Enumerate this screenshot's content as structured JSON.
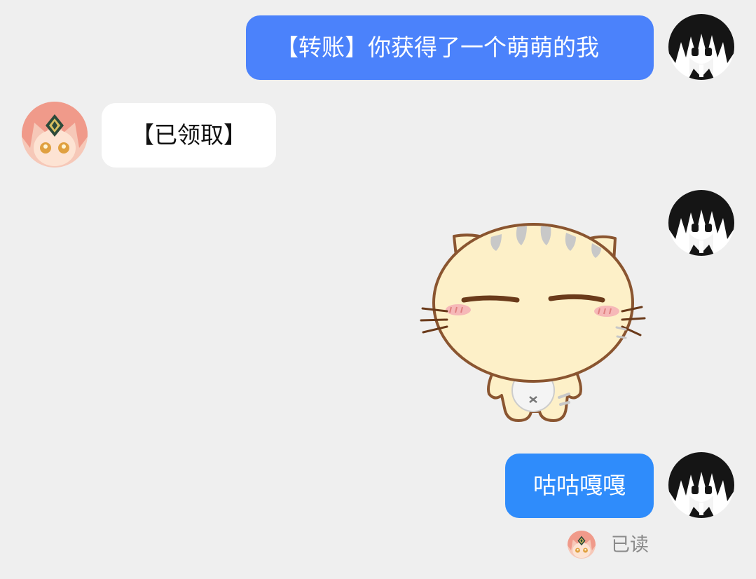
{
  "colors": {
    "background": "#efefef",
    "bubble_out_primary": "#4b82fb",
    "bubble_out_secondary": "#2f8cfb",
    "bubble_in": "#ffffff",
    "read_text": "#8a8a8a"
  },
  "messages": [
    {
      "direction": "outgoing",
      "type": "text",
      "text": "【转账】你获得了一个萌萌的我",
      "avatar": "dark-haired-avatar"
    },
    {
      "direction": "incoming",
      "type": "text",
      "text": "【已领取】",
      "avatar": "pink-haired-avatar"
    },
    {
      "direction": "outgoing",
      "type": "sticker",
      "sticker": "cute-cat-sticker",
      "avatar": "dark-haired-avatar"
    },
    {
      "direction": "outgoing",
      "type": "text",
      "text": "咕咕嘎嘎",
      "avatar": "dark-haired-avatar"
    }
  ],
  "read_receipt": {
    "label": "已读",
    "avatar": "pink-haired-avatar"
  }
}
